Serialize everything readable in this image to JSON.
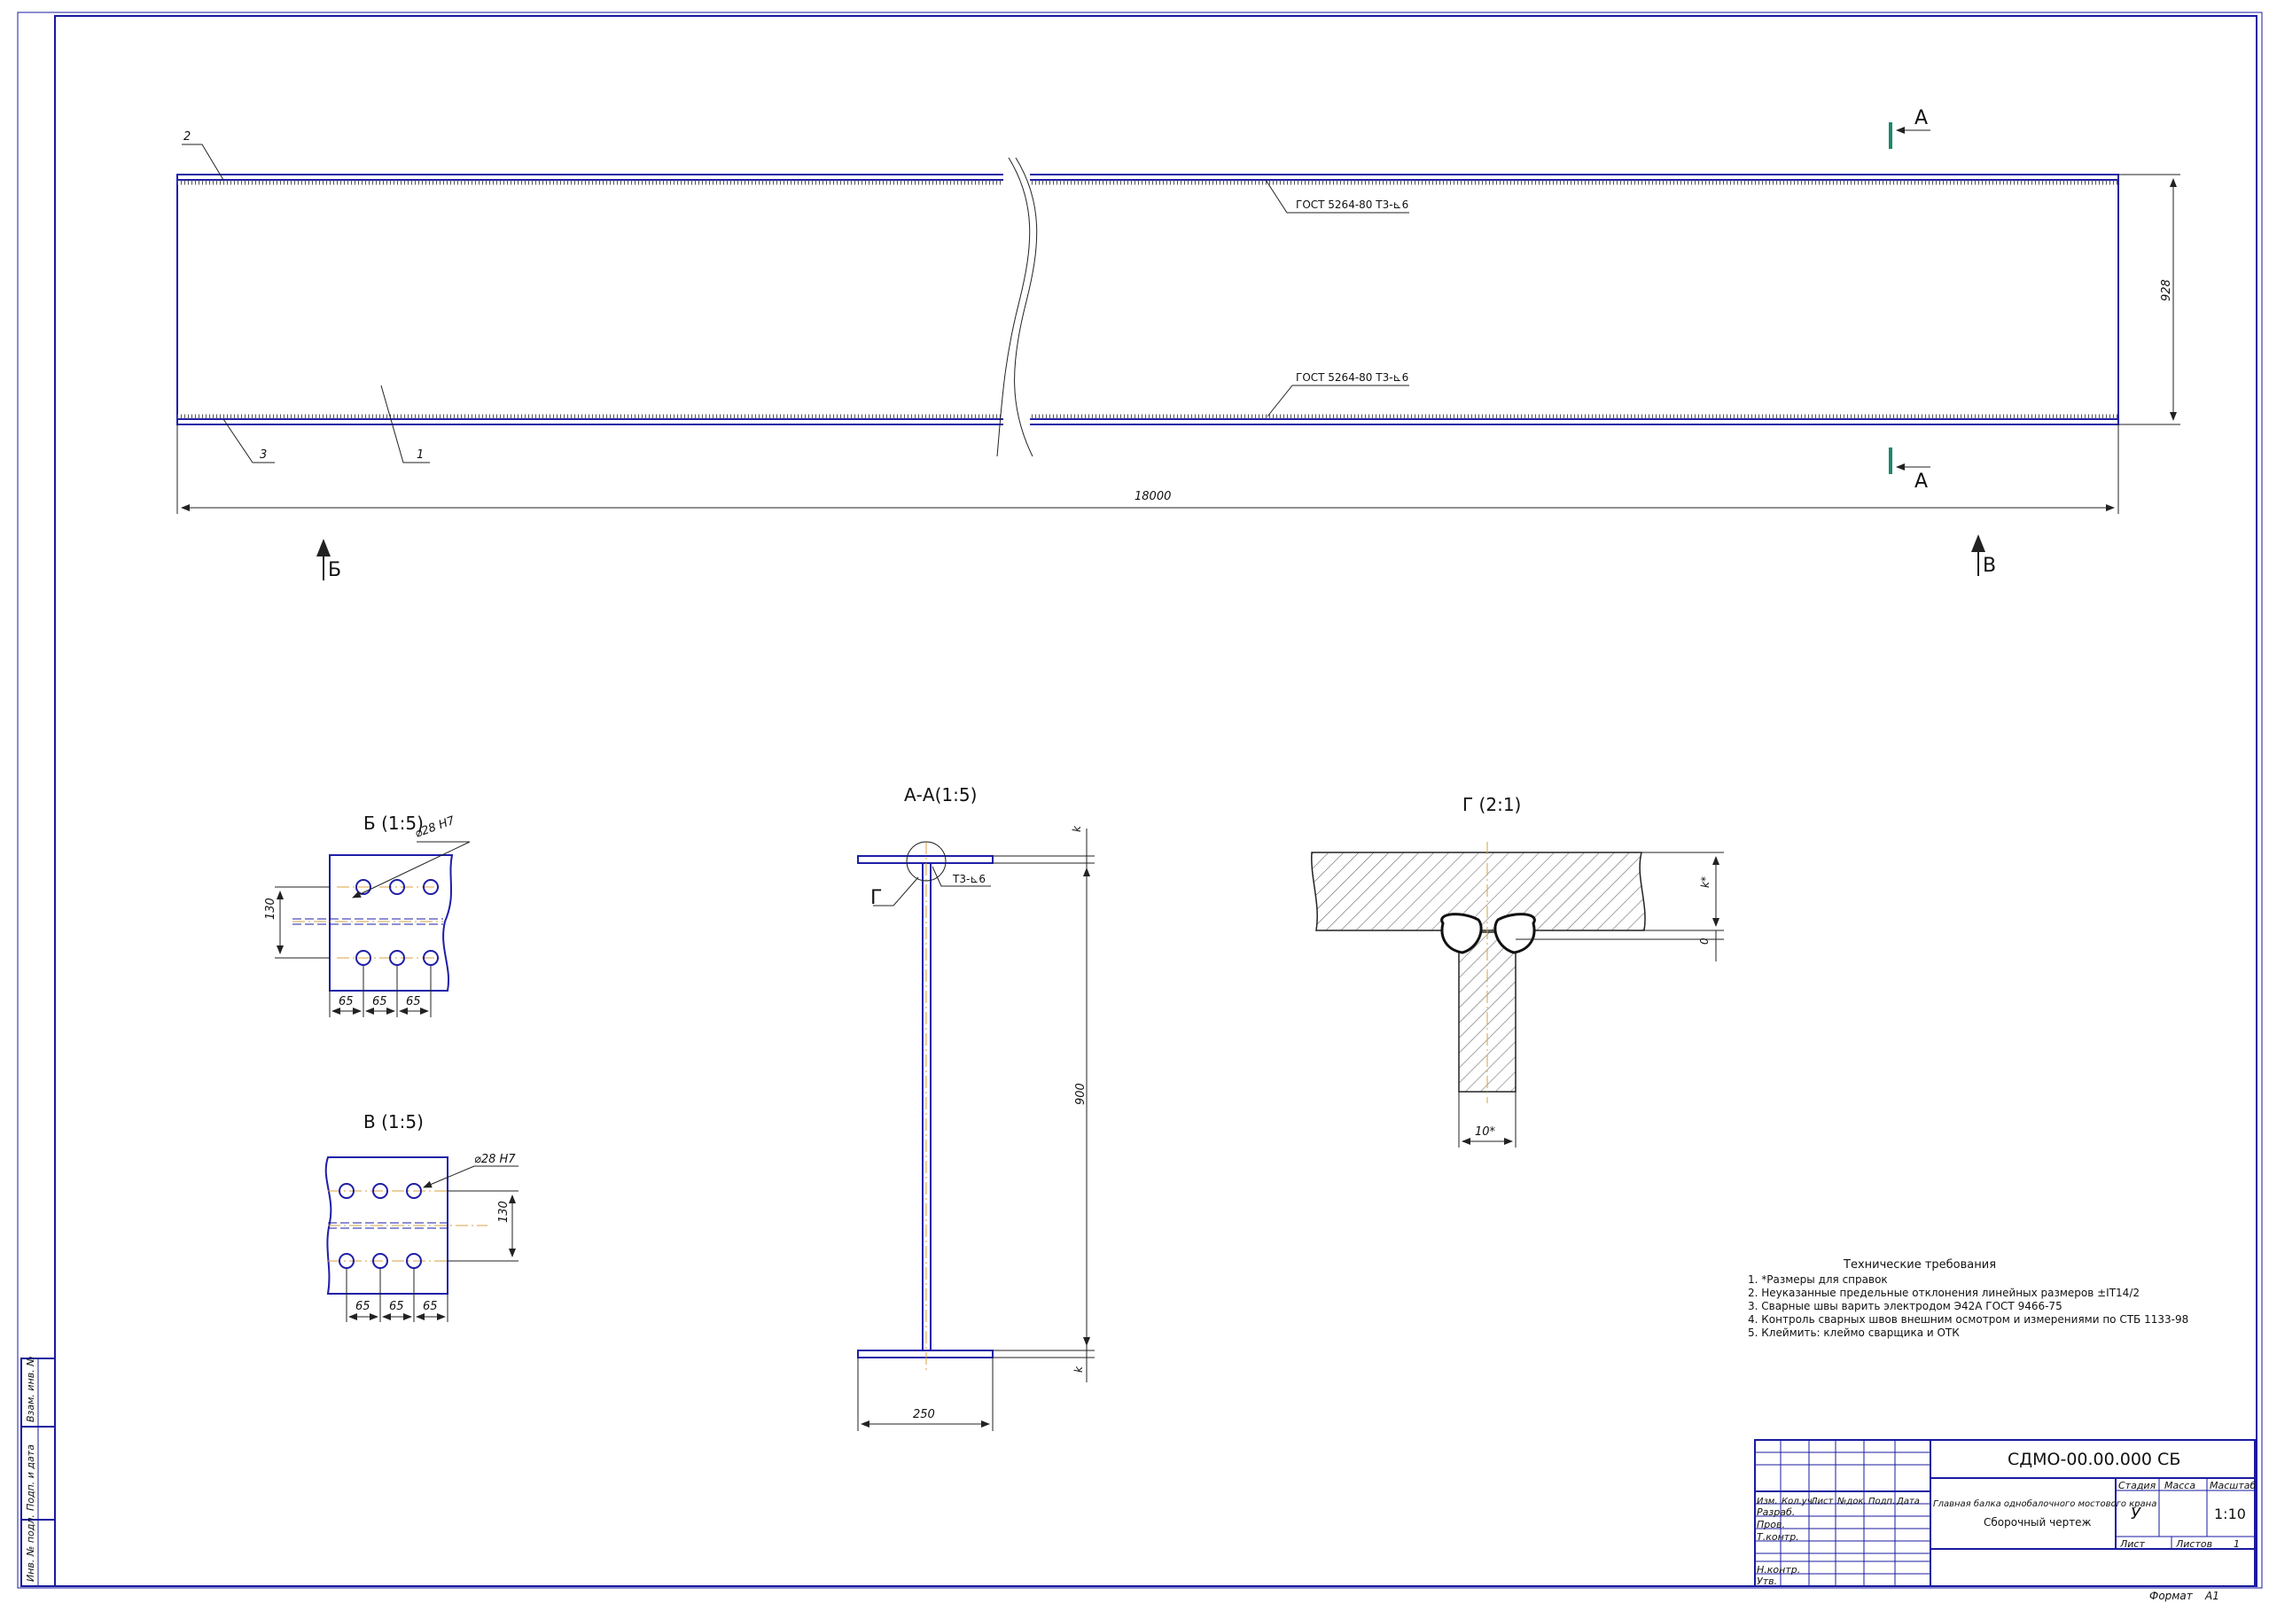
{
  "colors": {
    "frame": "#1a1aa0",
    "line": "#222222",
    "axis": "#d8a040",
    "section_mark": "#1a8a6a"
  },
  "main_view": {
    "callouts": [
      "1",
      "2",
      "3"
    ],
    "weld_note_top": "ГОСТ 5264-80 Т3-⊾6",
    "weld_note_bottom": "ГОСТ 5264-80 Т3-⊾6",
    "length_dim": "18000",
    "height_dim": "928",
    "section_mark": "А",
    "view_b": "Б",
    "view_v": "В"
  },
  "view_b": {
    "title": "Б (1:5)",
    "hole": "⌀28 H7",
    "spacing": [
      "65",
      "65",
      "65"
    ],
    "height": "130"
  },
  "view_v": {
    "title": "В (1:5)",
    "hole": "⌀28 H7",
    "spacing": [
      "65",
      "65",
      "65"
    ],
    "height": "130"
  },
  "section_aa": {
    "title": "А-А(1:5)",
    "weld": "Т3-⊾6",
    "detail_mark": "Г",
    "web_height": "900",
    "flange_width": "250",
    "flange_thk": "k"
  },
  "detail_g": {
    "title": "Г (2:1)",
    "flange_dim": "k*",
    "gap_dim": "0",
    "web_dim": "10*"
  },
  "tech_req": {
    "title": "Технические требования",
    "lines": [
      "1. *Размеры для справок",
      "2. Неуказанные предельные отклонения линейных размеров ±IT14/2",
      "3. Сварные швы варить электродом Э42А ГОСТ 9466-75",
      "4. Контроль сварных швов внешним осмотром и измерениями по СТБ 1133-98",
      "5. Клеймить: клеймо сварщика и ОТК"
    ]
  },
  "title_block": {
    "designation": "СДМО-00.00.000 СБ",
    "name_line1": "Главная балка однобалочного мостового крана",
    "name_line2": "Сборочный чертеж",
    "col_headers": [
      "Изм.",
      "Кол.уч.",
      "Лист",
      "№док.",
      "Подп.",
      "Дата"
    ],
    "roles": [
      "Разраб.",
      "Пров.",
      "Т.контр.",
      "",
      "Н.контр.",
      "Утв."
    ],
    "stage_label": "Стадия",
    "mass_label": "Масса",
    "scale_label": "Масштаб",
    "stage": "У",
    "scale": "1:10",
    "sheet_label": "Лист",
    "sheets_label": "Листов",
    "sheets": "1",
    "format_label": "Формат",
    "format": "А1"
  },
  "side_stamp": [
    "Инв. № подл.",
    "Подп. и дата",
    "Взам. инв. №"
  ]
}
